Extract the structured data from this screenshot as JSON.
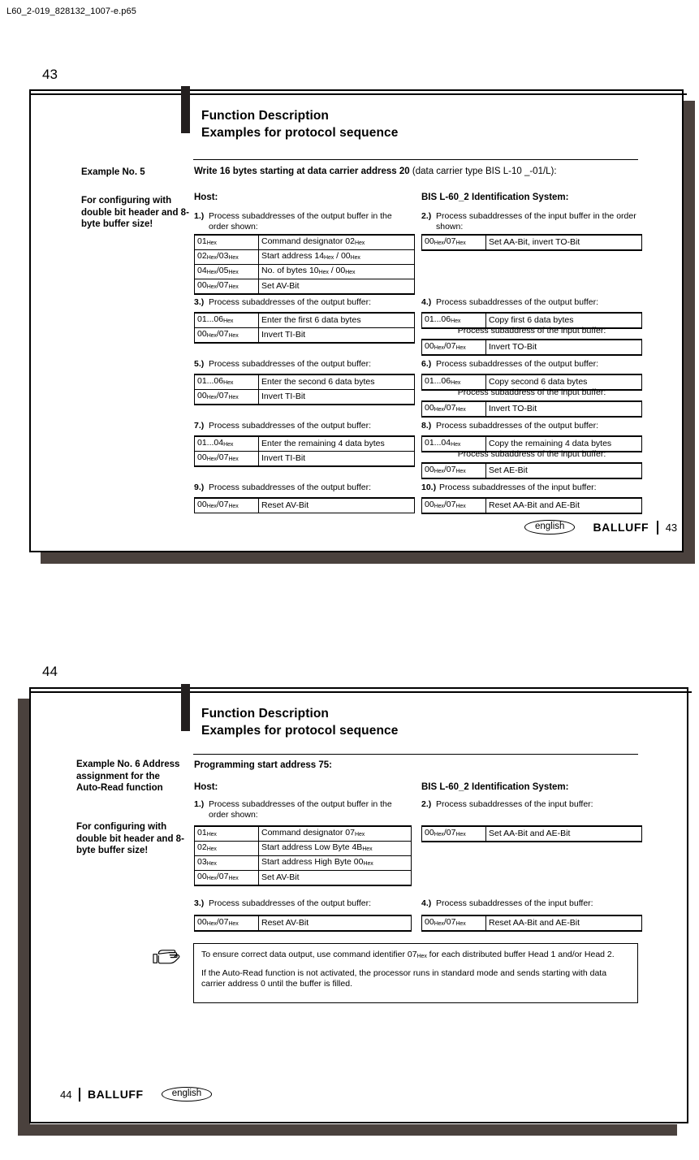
{
  "document": {
    "filename": "L60_2-019_828132_1007-e.p65"
  },
  "pages": [
    {
      "outer_number": "43",
      "header": {
        "line1": "Function Description",
        "line2": "Examples for protocol sequence"
      },
      "left_column": {
        "example_title": "Example No. 5",
        "note": "For configuring with double bit header and 8-byte buffer size!"
      },
      "main_heading_bold": "Write 16 bytes starting at data carrier address 20",
      "main_heading_regular": " (data carrier type BIS L-10 _-01/L):",
      "col_heading_left": "Host:",
      "col_heading_right": "BIS L-60_2 Identification System:",
      "steps": {
        "s1": {
          "num": "1.)",
          "text": "Process subaddresses of the output buffer in the order shown:"
        },
        "s2": {
          "num": "2.)",
          "text": "Process subaddresses of the input buffer in the order shown:"
        },
        "s3": {
          "num": "3.)",
          "text": "Process subaddresses of the output buffer:"
        },
        "s4": {
          "num": "4.)",
          "text": "Process subaddresses of the output buffer:"
        },
        "s5": {
          "num": "5.)",
          "text": "Process subaddresses of the output buffer:"
        },
        "s6": {
          "num": "6.)",
          "text": "Process subaddresses of the output buffer:"
        },
        "s7": {
          "num": "7.)",
          "text": "Process subaddresses of the output buffer:"
        },
        "s8": {
          "num": "8.)",
          "text": "Process subaddresses of the output buffer:"
        },
        "s9": {
          "num": "9.)",
          "text": "Process subaddresses of the output buffer:"
        },
        "s10": {
          "num": "10.)",
          "text": "Process subaddresses of the input buffer:"
        }
      },
      "inner_notes": {
        "n4": "Process subaddress of the input buffer:",
        "n6": "Process subaddress of the input buffer:",
        "n8": "Process subaddress of the input buffer:"
      },
      "tables": {
        "t1": [
          {
            "addr": "01Hex",
            "desc": "Command designator 02Hex"
          },
          {
            "addr": "02Hex/03Hex",
            "desc": "Start address 14Hex / 00Hex"
          },
          {
            "addr": "04Hex/05Hex",
            "desc": "No. of bytes 10Hex / 00Hex"
          },
          {
            "addr": "00Hex/07Hex",
            "desc": "Set AV-Bit"
          }
        ],
        "t2": [
          {
            "addr": "00Hex/07Hex",
            "desc": "Set AA-Bit, invert TO-Bit"
          }
        ],
        "t3": [
          {
            "addr": "01...06Hex",
            "desc": "Enter the first 6 data bytes"
          },
          {
            "addr": "00Hex/07Hex",
            "desc": "Invert TI-Bit"
          }
        ],
        "t4a": [
          {
            "addr": "01...06Hex",
            "desc": "Copy first 6 data bytes"
          }
        ],
        "t4b": [
          {
            "addr": "00Hex/07Hex",
            "desc": "Invert TO-Bit"
          }
        ],
        "t5": [
          {
            "addr": "01...06Hex",
            "desc": "Enter the second 6 data bytes"
          },
          {
            "addr": "00Hex/07Hex",
            "desc": "Invert TI-Bit"
          }
        ],
        "t6a": [
          {
            "addr": "01...06Hex",
            "desc": "Copy second 6 data bytes"
          }
        ],
        "t6b": [
          {
            "addr": "00Hex/07Hex",
            "desc": "Invert TO-Bit"
          }
        ],
        "t7": [
          {
            "addr": "01...04Hex",
            "desc": "Enter the remaining 4 data bytes"
          },
          {
            "addr": "00Hex/07Hex",
            "desc": "Invert TI-Bit"
          }
        ],
        "t8a": [
          {
            "addr": "01...04Hex",
            "desc": "Copy the remaining 4 data bytes"
          }
        ],
        "t8b": [
          {
            "addr": "00Hex/07Hex",
            "desc": "Set AE-Bit"
          }
        ],
        "t9": [
          {
            "addr": "00Hex/07Hex",
            "desc": "Reset AV-Bit"
          }
        ],
        "t10": [
          {
            "addr": "00Hex/07Hex",
            "desc": "Reset AA-Bit and AE-Bit"
          }
        ]
      },
      "footer": {
        "language": "english",
        "brand": "BALLUFF",
        "page_number": "43"
      }
    },
    {
      "outer_number": "44",
      "header": {
        "line1": "Function Description",
        "line2": "Examples for protocol sequence"
      },
      "left_column": {
        "example_title": "Example No. 6 Address assignment for the Auto-Read function",
        "note": "For configuring with double bit header and 8-byte buffer size!"
      },
      "main_heading_bold": "Programming start address 75:",
      "col_heading_left": "Host:",
      "col_heading_right": "BIS L-60_2 Identification System:",
      "steps": {
        "s1": {
          "num": "1.)",
          "text": "Process subaddresses of the output buffer in the order shown:"
        },
        "s2": {
          "num": "2.)",
          "text": "Process subaddresses of the input buffer:"
        },
        "s3": {
          "num": "3.)",
          "text": "Process subaddresses of the output buffer:"
        },
        "s4": {
          "num": "4.)",
          "text": "Process subaddresses of the input buffer:"
        }
      },
      "tables": {
        "t1": [
          {
            "addr": "01Hex",
            "desc": "Command designator 07Hex"
          },
          {
            "addr": "02Hex",
            "desc": "Start address Low Byte 4BHex"
          },
          {
            "addr": "03Hex",
            "desc": "Start address High Byte 00Hex"
          },
          {
            "addr": "00Hex/07Hex",
            "desc": "Set AV-Bit"
          }
        ],
        "t2": [
          {
            "addr": "00Hex/07Hex",
            "desc": "Set AA-Bit and AE-Bit"
          }
        ],
        "t3": [
          {
            "addr": "00Hex/07Hex",
            "desc": "Reset AV-Bit"
          }
        ],
        "t4": [
          {
            "addr": "00Hex/07Hex",
            "desc": "Reset AA-Bit and AE-Bit"
          }
        ]
      },
      "note_box": {
        "icon": "pointing-hand-icon",
        "paragraph1": "To ensure correct data output, use command identifier 07Hex for each distributed buffer Head 1 and/or Head 2.",
        "paragraph2": "If the Auto-Read function is not activated, the processor runs in standard mode and sends starting with data carrier address 0 until the buffer is filled."
      },
      "footer": {
        "page_number": "44",
        "brand": "BALLUFF",
        "language": "english"
      }
    }
  ],
  "colors": {
    "page_shadow": "#4a413d",
    "rule": "#000000",
    "paper": "#ffffff"
  }
}
